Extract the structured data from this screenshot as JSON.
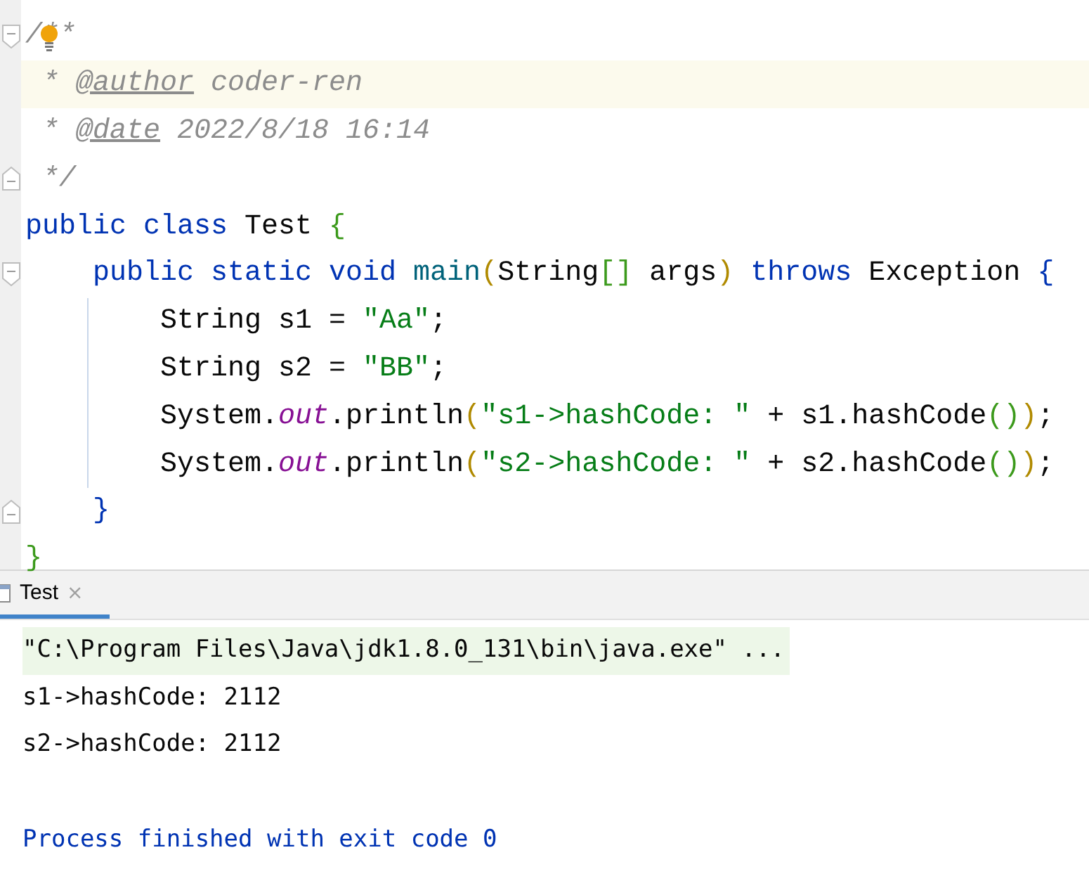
{
  "editor": {
    "lines": [
      {
        "fold_start": true,
        "fold_end": false,
        "bulb": true,
        "current": false,
        "guide": false,
        "tokens": [
          {
            "kind": "comment",
            "text": "/**"
          }
        ]
      },
      {
        "fold_start": false,
        "fold_end": false,
        "bulb": false,
        "current": true,
        "guide": false,
        "tokens": [
          {
            "kind": "comment",
            "text": " * "
          },
          {
            "kind": "doctag",
            "text": "@author"
          },
          {
            "kind": "comment",
            "text": " coder-ren"
          }
        ]
      },
      {
        "fold_start": false,
        "fold_end": false,
        "bulb": false,
        "current": false,
        "guide": false,
        "tokens": [
          {
            "kind": "comment",
            "text": " * "
          },
          {
            "kind": "doctag",
            "text": "@date"
          },
          {
            "kind": "comment",
            "text": " 2022/8/18 16:14"
          }
        ]
      },
      {
        "fold_start": false,
        "fold_end": true,
        "bulb": false,
        "current": false,
        "guide": false,
        "tokens": [
          {
            "kind": "comment",
            "text": " */"
          }
        ]
      },
      {
        "fold_start": false,
        "fold_end": false,
        "bulb": false,
        "current": false,
        "guide": false,
        "tokens": [
          {
            "kind": "keyword",
            "text": "public class"
          },
          {
            "kind": "plain",
            "text": " Test "
          },
          {
            "kind": "bracket-green",
            "text": "{"
          }
        ],
        "children": [
          {
            "fold_start": true,
            "fold_end": false,
            "bulb": false,
            "current": false,
            "guide": false,
            "tokens": [
              {
                "kind": "keyword",
                "text": "public static void"
              },
              {
                "kind": "method",
                "text": " main"
              },
              {
                "kind": "bracket-gold",
                "text": "("
              },
              {
                "kind": "plain",
                "text": "String"
              },
              {
                "kind": "bracket-green",
                "text": "[]"
              },
              {
                "kind": "plain",
                "text": " args"
              },
              {
                "kind": "bracket-gold",
                "text": ")"
              },
              {
                "kind": "keyword",
                "text": " throws"
              },
              {
                "kind": "plain",
                "text": " Exception "
              },
              {
                "kind": "bracket-blue",
                "text": "{"
              }
            ],
            "children": [
              {
                "fold_start": false,
                "fold_end": false,
                "bulb": false,
                "current": false,
                "guide": true,
                "tokens": [
                  {
                    "kind": "plain",
                    "text": "String s1 = "
                  },
                  {
                    "kind": "string",
                    "text": "\"Aa\""
                  },
                  {
                    "kind": "plain",
                    "text": ";"
                  }
                ]
              },
              {
                "fold_start": false,
                "fold_end": false,
                "bulb": false,
                "current": false,
                "guide": true,
                "tokens": [
                  {
                    "kind": "plain",
                    "text": "String s2 = "
                  },
                  {
                    "kind": "string",
                    "text": "\"BB\""
                  },
                  {
                    "kind": "plain",
                    "text": ";"
                  }
                ]
              },
              {
                "fold_start": false,
                "fold_end": false,
                "bulb": false,
                "current": false,
                "guide": true,
                "tokens": [
                  {
                    "kind": "plain",
                    "text": "System."
                  },
                  {
                    "kind": "field",
                    "text": "out"
                  },
                  {
                    "kind": "plain",
                    "text": ".println"
                  },
                  {
                    "kind": "bracket-gold",
                    "text": "("
                  },
                  {
                    "kind": "string",
                    "text": "\"s1->hashCode: \""
                  },
                  {
                    "kind": "plain",
                    "text": " + s1.hashCode"
                  },
                  {
                    "kind": "bracket-green",
                    "text": "()"
                  },
                  {
                    "kind": "bracket-gold",
                    "text": ")"
                  },
                  {
                    "kind": "plain",
                    "text": ";"
                  }
                ]
              },
              {
                "fold_start": false,
                "fold_end": false,
                "bulb": false,
                "current": false,
                "guide": true,
                "tokens": [
                  {
                    "kind": "plain",
                    "text": "System."
                  },
                  {
                    "kind": "field",
                    "text": "out"
                  },
                  {
                    "kind": "plain",
                    "text": ".println"
                  },
                  {
                    "kind": "bracket-gold",
                    "text": "("
                  },
                  {
                    "kind": "string",
                    "text": "\"s2->hashCode: \""
                  },
                  {
                    "kind": "plain",
                    "text": " + s2.hashCode"
                  },
                  {
                    "kind": "bracket-green",
                    "text": "()"
                  },
                  {
                    "kind": "bracket-gold",
                    "text": ")"
                  },
                  {
                    "kind": "plain",
                    "text": ";"
                  }
                ]
              }
            ]
          },
          {
            "fold_start": false,
            "fold_end": true,
            "bulb": false,
            "current": false,
            "guide": false,
            "tokens": [
              {
                "kind": "bracket-blue",
                "text": "}"
              }
            ]
          }
        ]
      },
      {
        "fold_start": false,
        "fold_end": false,
        "bulb": false,
        "current": false,
        "guide": false,
        "tokens": [
          {
            "kind": "bracket-green",
            "text": "}"
          }
        ]
      }
    ]
  },
  "run_panel": {
    "tabs": [
      {
        "label": "Test",
        "close": "×",
        "selected": true
      }
    ],
    "console": [
      {
        "kind": "command",
        "text": "\"C:\\Program Files\\Java\\jdk1.8.0_131\\bin\\java.exe\" ..."
      },
      {
        "kind": "output",
        "text": "s1->hashCode: 2112"
      },
      {
        "kind": "output",
        "text": "s2->hashCode: 2112"
      },
      {
        "kind": "exit",
        "text": "Process finished with exit code 0"
      }
    ]
  }
}
